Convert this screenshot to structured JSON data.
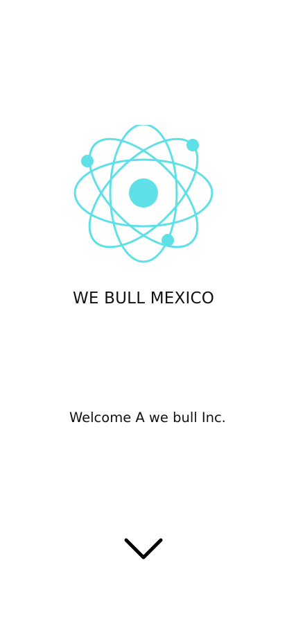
{
  "brand": {
    "title": "WE BULL MEXICO",
    "logo_icon": "atom-icon",
    "accent_color": "#5ee0e6"
  },
  "main": {
    "welcome_text": "Welcome A we bull Inc."
  },
  "navigation": {
    "scroll_icon": "chevron-down-icon"
  }
}
